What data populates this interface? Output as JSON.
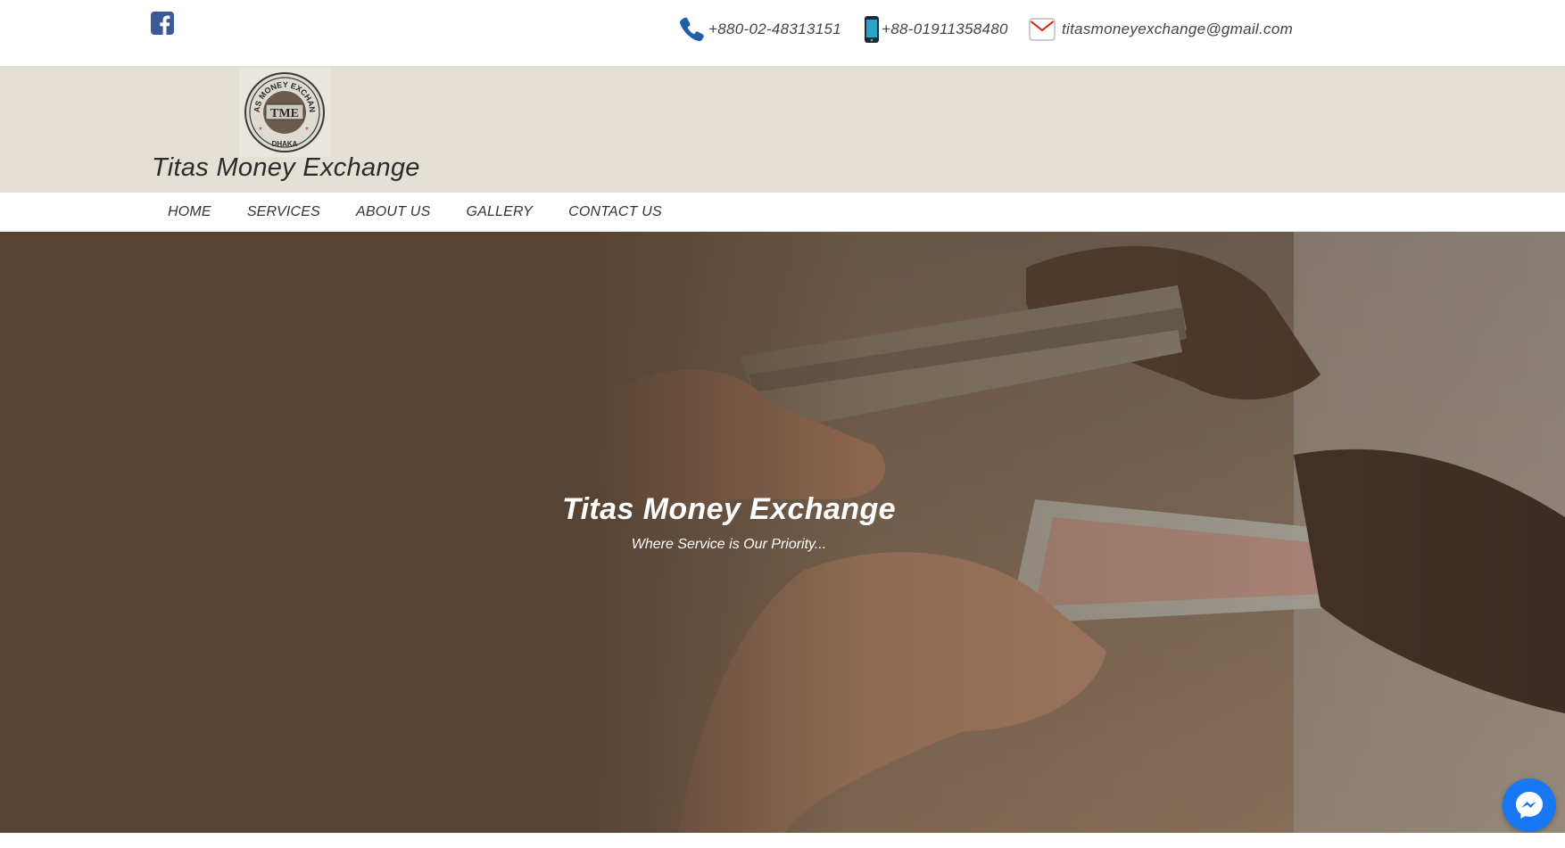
{
  "topbar": {
    "phone": "+880-02-48313151",
    "mobile": "+88-01911358480",
    "email": "titasmoneyexchange@gmail.com"
  },
  "brand": {
    "name": "Titas Money Exchange",
    "logo_text_top": "TITAS MONEY EXCHANGE",
    "logo_initials": "TME",
    "logo_text_bottom": "DHAKA"
  },
  "nav": {
    "items": [
      {
        "label": "HOME"
      },
      {
        "label": "SERVICES"
      },
      {
        "label": "ABOUT US"
      },
      {
        "label": "GALLERY"
      },
      {
        "label": "CONTACT US"
      }
    ]
  },
  "hero": {
    "title": "Titas Money Exchange",
    "subtitle": "Where Service is Our Priority..."
  },
  "colors": {
    "facebook": "#3b5998",
    "phone_icon": "#1f5fa8",
    "mobile_icon": "#2aa5c9",
    "email_icon": "#d93025",
    "brand_band": "#e4e0d5",
    "hero_overlay": "#584434",
    "messenger": "#1877f2"
  },
  "icons": [
    "facebook-icon",
    "phone-icon",
    "mobile-icon",
    "email-icon",
    "messenger-icon"
  ]
}
